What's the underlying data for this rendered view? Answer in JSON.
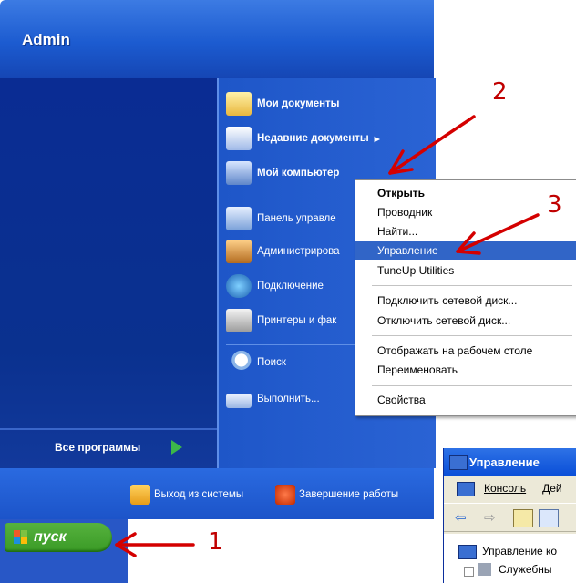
{
  "user": {
    "name": "Admin"
  },
  "right_menu": [
    {
      "label": "Мои документы",
      "icon": "folder-documents-icon",
      "bold": true
    },
    {
      "label": "Недавние документы",
      "icon": "recent-documents-icon",
      "bold": true,
      "submenu_marker": "▸"
    },
    {
      "label": "Мой компьютер",
      "icon": "computer-icon",
      "bold": true
    },
    {
      "label": "Панель управле",
      "icon": "control-panel-icon"
    },
    {
      "label": "Администрирова",
      "icon": "admin-tools-icon"
    },
    {
      "label": "Подключение",
      "icon": "network-connection-icon"
    },
    {
      "label": "Принтеры и фак",
      "icon": "printer-icon"
    },
    {
      "label": "Поиск",
      "icon": "search-icon"
    },
    {
      "label": "Выполнить...",
      "icon": "run-icon"
    }
  ],
  "all_programs": "Все программы",
  "footer": {
    "logoff": "Выход из системы",
    "shutdown": "Завершение работы"
  },
  "start_button": "пуск",
  "context_menu": [
    {
      "label": "Открыть",
      "bold": true
    },
    {
      "label": "Проводник"
    },
    {
      "label": "Найти..."
    },
    {
      "label": "Управление",
      "highlighted": true
    },
    {
      "label": "TuneUp Utilities"
    },
    {
      "label": "Подключить сетевой диск..."
    },
    {
      "label": "Отключить сетевой диск..."
    },
    {
      "label": "Отображать на рабочем столе"
    },
    {
      "label": "Переименовать"
    },
    {
      "label": "Свойства"
    }
  ],
  "management_window": {
    "title": "Управление",
    "menu_console": "Консоль",
    "menu_action": "Дей",
    "tree_root": "Управление ко",
    "tree_child": "Служебны"
  },
  "annotations": {
    "n1": "1",
    "n2": "2",
    "n3": "3"
  },
  "colors": {
    "accent": "#1c5bd0",
    "left_pane": "#0a2c93",
    "highlight": "#3165c7",
    "arrow": "#d40000"
  }
}
